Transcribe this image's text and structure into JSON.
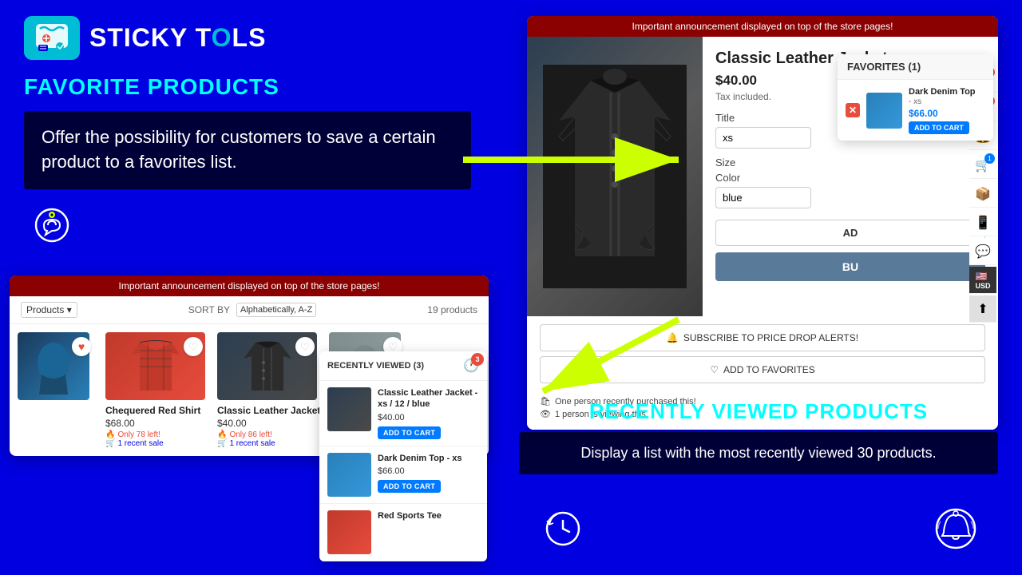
{
  "logo": {
    "text_part1": "STICKY T",
    "text_o": "O",
    "text_part2": "LS"
  },
  "left": {
    "favorite_title": "FAVORITE PRODUCTS",
    "description": "Offer the possibility for customers to save a certain product to a favorites list.",
    "store_announcement": "Important announcement displayed on top of the store pages!",
    "toolbar": {
      "sort_label": "SORT BY",
      "sort_value": "Alphabetically, A-Z",
      "products_count": "19 products"
    },
    "products": [
      {
        "name": "Chequered Red Shirt",
        "price": "$68.00",
        "stock": "Only 78 left!",
        "sales": "1 recent sale"
      },
      {
        "name": "Classic Leather Jacket",
        "price": "$40.00",
        "stock": "Only 86 left!",
        "sales": "1 recent sale"
      }
    ],
    "recently_viewed": {
      "header": "RECENTLY VIEWED (3)",
      "items": [
        {
          "name": "Classic Leather Jacket - xs / 12 / blue",
          "price": "$40.00",
          "add_to_cart": "ADD TO CART"
        },
        {
          "name": "Dark Denim Top - xs",
          "price": "$66.00",
          "add_to_cart": "ADD TO CART"
        },
        {
          "name": "Red Sports Tee",
          "price": ""
        }
      ]
    }
  },
  "right": {
    "store_announcement": "Important announcement displayed on top of the store pages!",
    "product": {
      "title": "Classic Leather Jacket",
      "price": "$40.00",
      "tax": "Tax included.",
      "title_label": "Title",
      "title_value": "xs",
      "size_label": "Size",
      "color_label": "Color",
      "color_value": "blue",
      "add_to_cart_label": "AD",
      "buy_label": "BU"
    },
    "favorites_popup": {
      "header": "FAVORITES (1)",
      "item_name": "Dark Denim Top",
      "item_variant": "- xs",
      "item_price": "$66.00",
      "add_to_cart": "ADD TO CART"
    },
    "buttons": {
      "subscribe": "SUBSCRIBE TO PRICE DROP ALERTS!",
      "add_to_favorites": "ADD TO FAVORITES"
    },
    "social": {
      "purchased": "One person recently purchased this!",
      "viewing": "1 person is viewing this."
    },
    "recently_viewed_title": "RECENTLY VIEWED PRODUCTS",
    "recently_viewed_desc": "Display a list with the most recently viewed 30 products.",
    "currency": "USD"
  }
}
